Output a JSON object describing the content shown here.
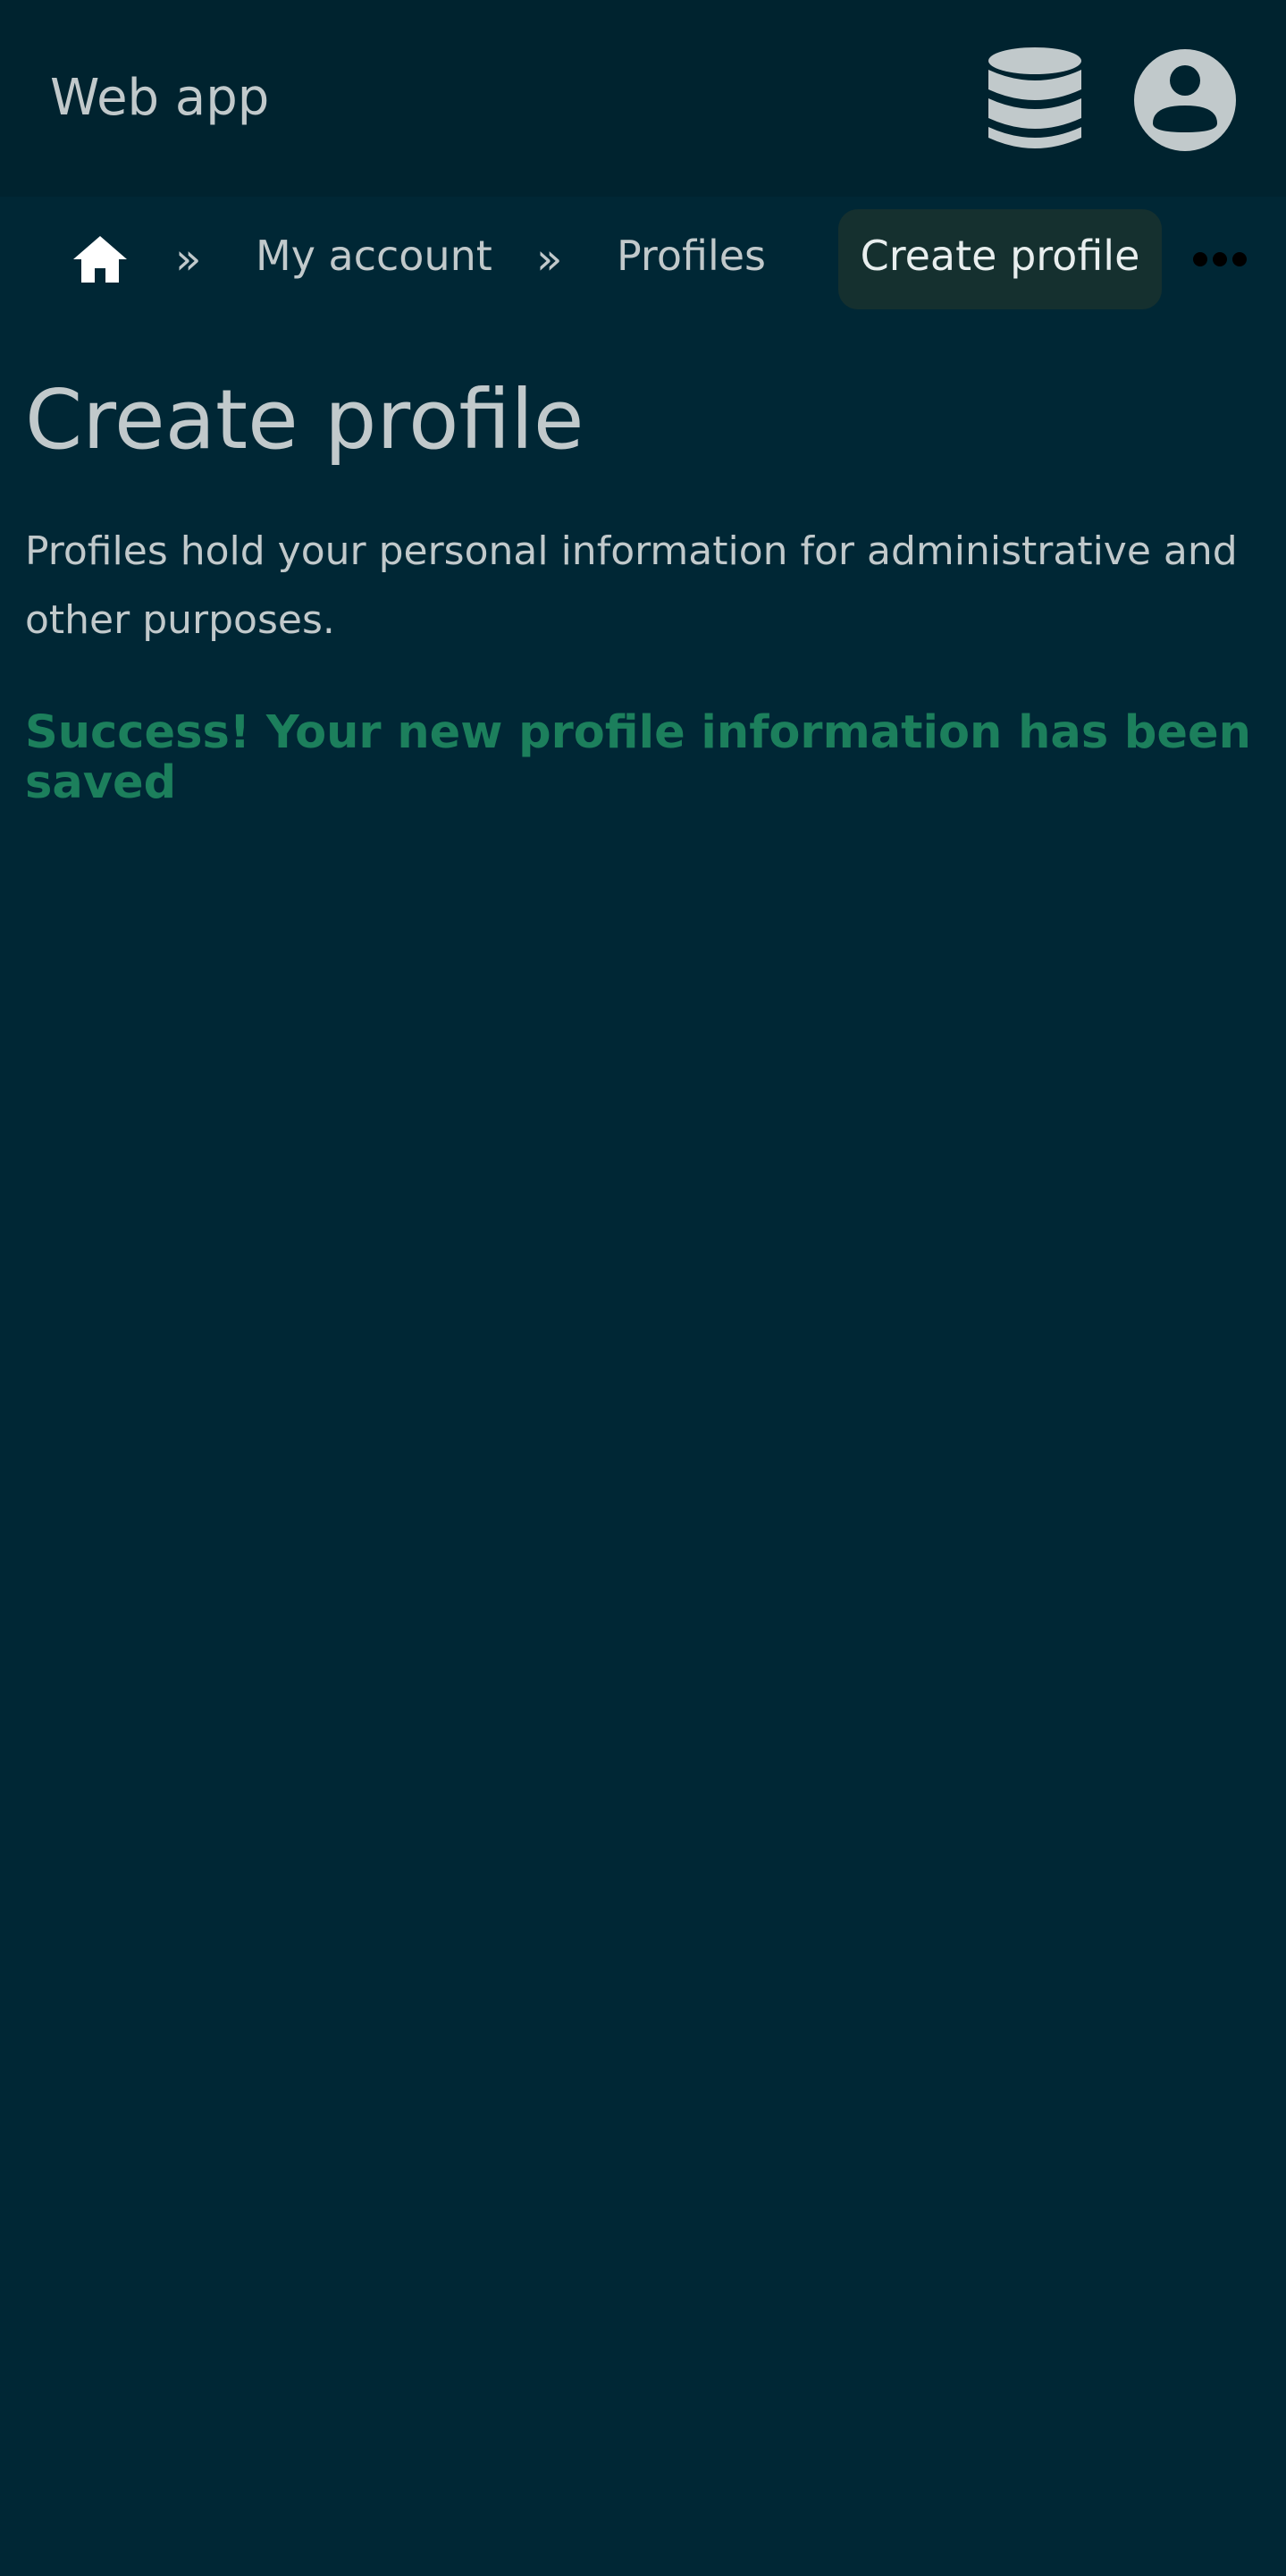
{
  "app": {
    "title": "Web app"
  },
  "header": {
    "icons": [
      "database-icon",
      "account-circle-icon"
    ]
  },
  "breadcrumb": {
    "home_icon": "home-icon",
    "separator": "»",
    "items": [
      {
        "label": "My account"
      },
      {
        "label": "Profiles"
      },
      {
        "label": "Create profile",
        "current": true
      }
    ],
    "more_icon": "more-horizontal-icon"
  },
  "main": {
    "title": "Create profile",
    "description": "Profiles hold your personal information for administrative and other purposes.",
    "success_message": "Success! Your new profile information has been saved"
  },
  "colors": {
    "background": "#002735",
    "header_background": "#00232f",
    "text": "#c1c9cb",
    "current_crumb_background": "#15302f",
    "success": "#1c7f5c"
  }
}
